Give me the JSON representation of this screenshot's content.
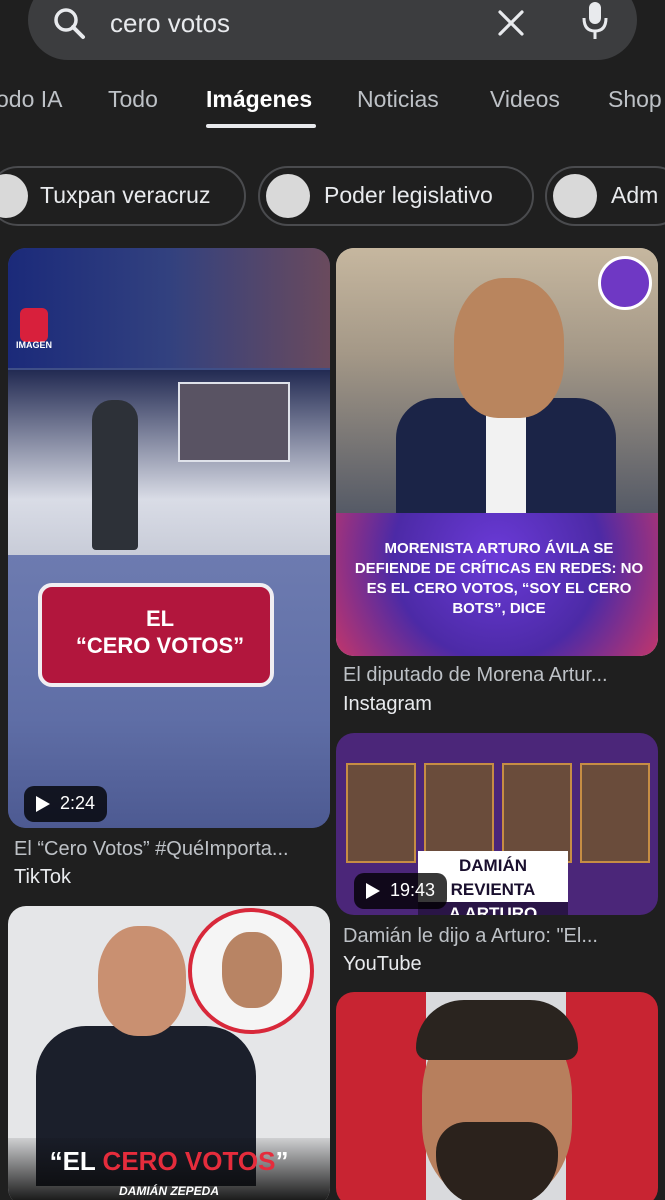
{
  "search": {
    "query": "cero votos"
  },
  "tabs": [
    {
      "label": "odo IA"
    },
    {
      "label": "Todo"
    },
    {
      "label": "Imágenes"
    },
    {
      "label": "Noticias"
    },
    {
      "label": "Videos"
    },
    {
      "label": "Shop"
    }
  ],
  "active_tab": "Imágenes",
  "chips": [
    {
      "label": "Tuxpan veracruz"
    },
    {
      "label": "Poder legislativo"
    },
    {
      "label": "Adm"
    }
  ],
  "results": [
    {
      "caption": "El “Cero Votos” #QuéImporta...",
      "source": "TikTok",
      "duration": "2:24",
      "overlay_text": "EL\n“CERO VOTOS”",
      "watermark": "IMAGEN"
    },
    {
      "caption": "El diputado de Morena Artur...",
      "source": "Instagram",
      "overlay_text": "MORENISTA ARTURO ÁVILA SE DEFIENDE DE CRÍTICAS EN REDES: NO ES EL CERO VOTOS, “SOY EL CERO BOTS”, DICE"
    },
    {
      "caption": "Damián le dijo a Arturo: \"El...",
      "source": "YouTube",
      "duration": "19:43",
      "overlay_line1": "DAMIÁN REVIENTA",
      "overlay_line2": "A ARTURO"
    },
    {
      "overlay_text_white": "“EL ",
      "overlay_text_red": "CERO VOTOS",
      "overlay_text_end": "”",
      "overlay_sub": "DAMIÁN ZEPEDA"
    },
    {}
  ],
  "colors": {
    "background": "#1f1f1f",
    "search_bar": "#3c3d3f",
    "text_primary": "#e8eaed",
    "text_secondary": "#bdc1c6"
  }
}
